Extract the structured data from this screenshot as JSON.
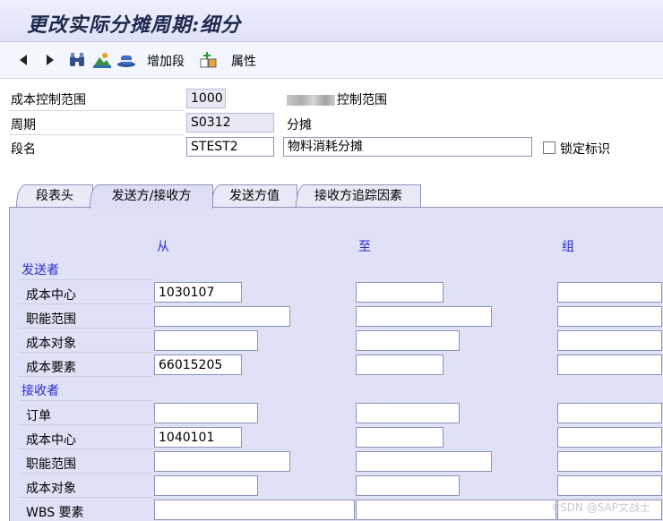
{
  "window": {
    "title": "更改实际分摊周期:细分"
  },
  "toolbar": {
    "icons": [
      "back-arrow-icon",
      "forward-arrow-icon",
      "binoculars-icon",
      "picture-icon",
      "hat-icon",
      "add-segment-icon"
    ],
    "add_segment": "增加段",
    "attributes": "属性"
  },
  "header": {
    "controlling_area_label": "成本控制范围",
    "controlling_area_value": "1000",
    "controlling_area_desc": "控制范围",
    "cycle_label": "周期",
    "cycle_value": "S0312",
    "cycle_desc": "分摊",
    "segment_label": "段名",
    "segment_value": "STEST2",
    "segment_desc": "物料消耗分摊",
    "lock_label": "锁定标识"
  },
  "tabs": [
    {
      "label": "段表头",
      "active": false
    },
    {
      "label": "发送方/接收方",
      "active": true
    },
    {
      "label": "发送方值",
      "active": false
    },
    {
      "label": "接收方追踪因素",
      "active": false
    }
  ],
  "columns": {
    "from": "从",
    "to": "至",
    "group": "组"
  },
  "sender": {
    "title": "发送者",
    "rows": [
      {
        "label": "成本中心",
        "from": "1030107",
        "to": "",
        "group": ""
      },
      {
        "label": "职能范围",
        "from": "",
        "to": "",
        "group": ""
      },
      {
        "label": "成本对象",
        "from": "",
        "to": "",
        "group": ""
      },
      {
        "label": "成本要素",
        "from": "66015205",
        "to": "",
        "group": ""
      }
    ]
  },
  "receiver": {
    "title": "接收者",
    "rows": [
      {
        "label": "订单",
        "from": "",
        "to": "",
        "group": ""
      },
      {
        "label": "成本中心",
        "from": "1040101",
        "to": "",
        "group": ""
      },
      {
        "label": "职能范围",
        "from": "",
        "to": "",
        "group": ""
      },
      {
        "label": "成本对象",
        "from": "",
        "to": "",
        "group": ""
      },
      {
        "label": "WBS 要素",
        "from": "",
        "to": "",
        "group": ""
      }
    ]
  },
  "watermark": "CSDN @SAP文战士",
  "colors": {
    "title_bg": "#dfe2f7",
    "panel_bg": "#dfe1f6",
    "accent_blue": "#2b2bd0"
  }
}
